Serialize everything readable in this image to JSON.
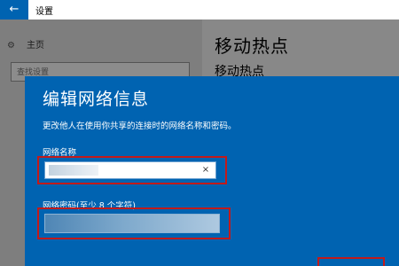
{
  "window": {
    "title": "设置",
    "back_icon": "←"
  },
  "sidebar": {
    "home_label": "主页",
    "search_placeholder": "查找设置"
  },
  "main": {
    "page_title": "移动热点",
    "section_title": "移动热点"
  },
  "dialog": {
    "title": "编辑网络信息",
    "description": "更改他人在使用你共享的连接时的网络名称和密码。",
    "name_label": "网络名称",
    "password_label": "网络密码(至少 8 个字符)",
    "clear_icon": "×"
  },
  "colors": {
    "accent": "#0063b1",
    "highlight": "#c21a1a"
  }
}
